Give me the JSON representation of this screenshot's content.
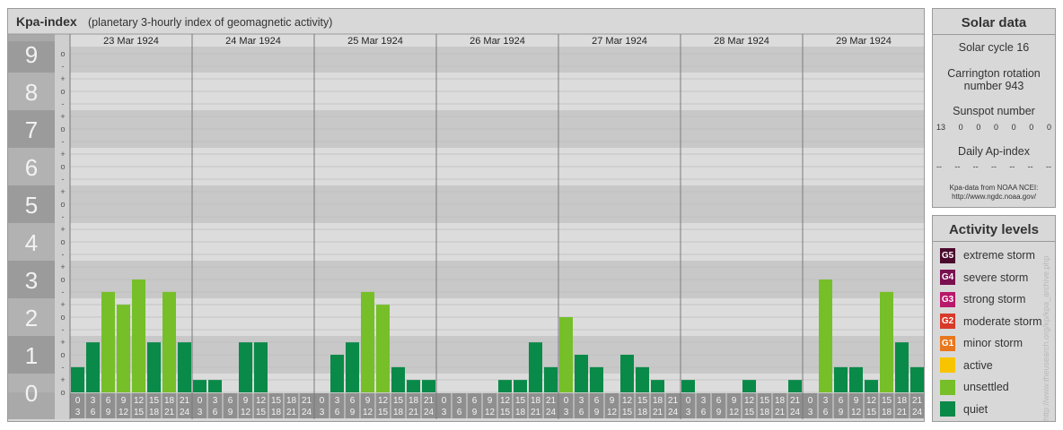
{
  "header": {
    "title": "Kpa-index",
    "subtitle": "(planetary 3-hourly index of geomagnetic activity)"
  },
  "chart_data": {
    "type": "bar",
    "y_levels": [
      "0",
      "1",
      "2",
      "3",
      "4",
      "5",
      "6",
      "7",
      "8",
      "9"
    ],
    "y_sub_ticks": [
      "-",
      "o",
      "+"
    ],
    "ylim": [
      0,
      9.33
    ],
    "days": [
      "23 Mar 1924",
      "24 Mar 1924",
      "25 Mar 1924",
      "26 Mar 1924",
      "27 Mar 1924",
      "28 Mar 1924",
      "29 Mar 1924"
    ],
    "interval_labels": [
      [
        "0",
        "3"
      ],
      [
        "3",
        "6"
      ],
      [
        "6",
        "9"
      ],
      [
        "9",
        "12"
      ],
      [
        "12",
        "15"
      ],
      [
        "15",
        "18"
      ],
      [
        "18",
        "21"
      ],
      [
        "21",
        "24"
      ]
    ],
    "values": [
      [
        0.67,
        1.33,
        2.67,
        2.33,
        3.0,
        1.33,
        2.67,
        1.33
      ],
      [
        0.33,
        0.33,
        0.0,
        1.33,
        1.33,
        0.0,
        0.0,
        0.0
      ],
      [
        0.0,
        1.0,
        1.33,
        2.67,
        2.33,
        0.67,
        0.33,
        0.33
      ],
      [
        0.0,
        0.0,
        0.0,
        0.0,
        0.33,
        0.33,
        1.33,
        0.67
      ],
      [
        2.0,
        1.0,
        0.67,
        0.0,
        1.0,
        0.67,
        0.33,
        0.0
      ],
      [
        0.33,
        0.0,
        0.0,
        0.0,
        0.33,
        0.0,
        0.0,
        0.33
      ],
      [
        0.0,
        3.0,
        0.67,
        0.67,
        0.33,
        2.67,
        1.33,
        0.67
      ]
    ],
    "level_colors": {
      "quiet": "#0a8a48",
      "unsettled": "#76bf29"
    },
    "grid": true
  },
  "sidebar": {
    "solar": {
      "title": "Solar data",
      "solar_cycle": "Solar cycle 16",
      "carrington_line1": "Carrington rotation",
      "carrington_line2": "number 943",
      "sunspot_title": "Sunspot number",
      "sunspot_values": [
        "13",
        "0",
        "0",
        "0",
        "0",
        "0",
        "0"
      ],
      "ap_title": "Daily Ap-index",
      "ap_values": [
        "--",
        "--",
        "--",
        "--",
        "--",
        "--",
        "--"
      ],
      "note_line1": "Kpa-data from NOAA NCEI:",
      "note_line2": "http://www.ngdc.noaa.gov/"
    },
    "activity": {
      "title": "Activity levels",
      "items": [
        {
          "badge": "G5",
          "label": "extreme storm",
          "color": "#4a0a2c"
        },
        {
          "badge": "G4",
          "label": "severe storm",
          "color": "#7a1050"
        },
        {
          "badge": "G3",
          "label": "strong storm",
          "color": "#b8186a"
        },
        {
          "badge": "G2",
          "label": "moderate storm",
          "color": "#d83a2a"
        },
        {
          "badge": "G1",
          "label": "minor storm",
          "color": "#e8781e"
        },
        {
          "badge": "",
          "label": "active",
          "color": "#f8c400"
        },
        {
          "badge": "",
          "label": "unsettled",
          "color": "#76bf29"
        },
        {
          "badge": "",
          "label": "quiet",
          "color": "#0a8a48"
        }
      ]
    }
  },
  "credit": "http://www.theusearch.org/kp/kpa_archive.php"
}
